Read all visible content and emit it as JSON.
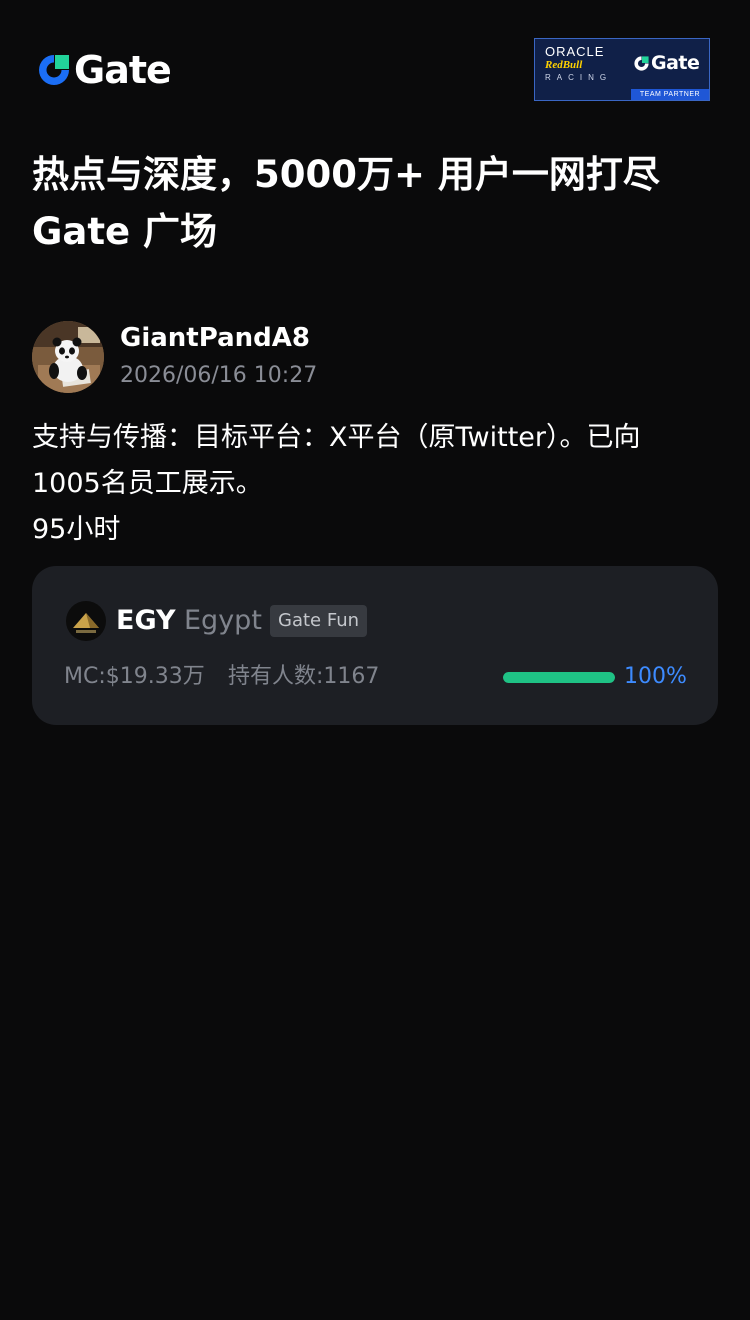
{
  "brand": {
    "logo_text": "Gate",
    "partner_badge": {
      "oracle": "ORACLE",
      "redbull": "RedBull",
      "racing": "RACING",
      "gate": "Gate",
      "team_partner": "TEAM PARTNER"
    }
  },
  "headline": {
    "line1": "热点与深度，5000万+ 用户一网打尽",
    "line2": "Gate 广场"
  },
  "post": {
    "username": "GiantPandA8",
    "timestamp": "2026/06/16 10:27",
    "body_line1": "支持与传播：目标平台：X平台（原Twitter）。已向",
    "body_line2": "1005名员工展示。",
    "body_line3": "95小时"
  },
  "token": {
    "symbol": "EGY",
    "name": "Egypt",
    "tag": "Gate Fun",
    "market_cap": "MC:$19.33万",
    "holders": "持有人数:1167",
    "progress_percent": 100,
    "progress_label": "100%"
  },
  "colors": {
    "background": "#0a0a0b",
    "card": "#1d1f24",
    "accent_green": "#1fc285",
    "accent_blue": "#3d8bff",
    "brand_blue": "#0d6efd"
  }
}
